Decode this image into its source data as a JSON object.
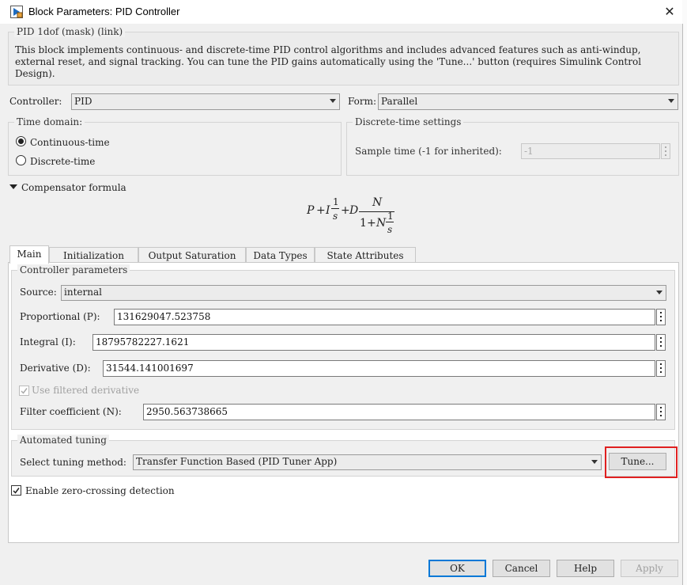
{
  "window": {
    "title": "Block Parameters: PID Controller"
  },
  "mask": {
    "header": "PID 1dof (mask) (link)",
    "description": "This block implements continuous- and discrete-time PID control algorithms and includes advanced features such as anti-windup, external reset, and signal tracking. You can tune the PID gains automatically using the 'Tune...' button (requires Simulink Control Design)."
  },
  "controller": {
    "label": "Controller:",
    "value": "PID"
  },
  "form": {
    "label": "Form:",
    "value": "Parallel"
  },
  "time_domain": {
    "title": "Time domain:",
    "options": [
      {
        "label": "Continuous-time",
        "selected": true
      },
      {
        "label": "Discrete-time",
        "selected": false
      }
    ]
  },
  "discrete_settings": {
    "title": "Discrete-time settings",
    "sample_time_label": "Sample time (-1 for inherited):",
    "sample_time_value": "-1"
  },
  "compensator": {
    "label": "Compensator formula",
    "formula": {
      "p": "P",
      "plus1": "+",
      "i": "I",
      "one1": "1",
      "s1": "s",
      "plus2": "+",
      "d": "D",
      "n": "N",
      "den_one": "1",
      "plus3": "+",
      "den_n": "N",
      "one2": "1",
      "s2": "s"
    }
  },
  "tabs": [
    "Main",
    "Initialization",
    "Output Saturation",
    "Data Types",
    "State Attributes"
  ],
  "controller_parameters": {
    "title": "Controller parameters",
    "source_label": "Source:",
    "source_value": "internal",
    "proportional_label": "Proportional (P):",
    "proportional_value": "131629047.523758",
    "integral_label": "Integral (I):",
    "integral_value": "18795782227.1621",
    "derivative_label": "Derivative (D):",
    "derivative_value": "31544.141001697",
    "filtered_label": "Use filtered derivative",
    "filter_label": "Filter coefficient (N):",
    "filter_value": "2950.563738665"
  },
  "automated_tuning": {
    "title": "Automated tuning",
    "method_label": "Select tuning method:",
    "method_value": "Transfer Function Based (PID Tuner App)",
    "tune_button": "Tune..."
  },
  "zero_crossing_label": "Enable zero-crossing detection",
  "buttons": {
    "ok": "OK",
    "cancel": "Cancel",
    "help": "Help",
    "apply": "Apply"
  },
  "colors": {
    "highlight": "#e02020",
    "ok_border": "#0078d7"
  }
}
